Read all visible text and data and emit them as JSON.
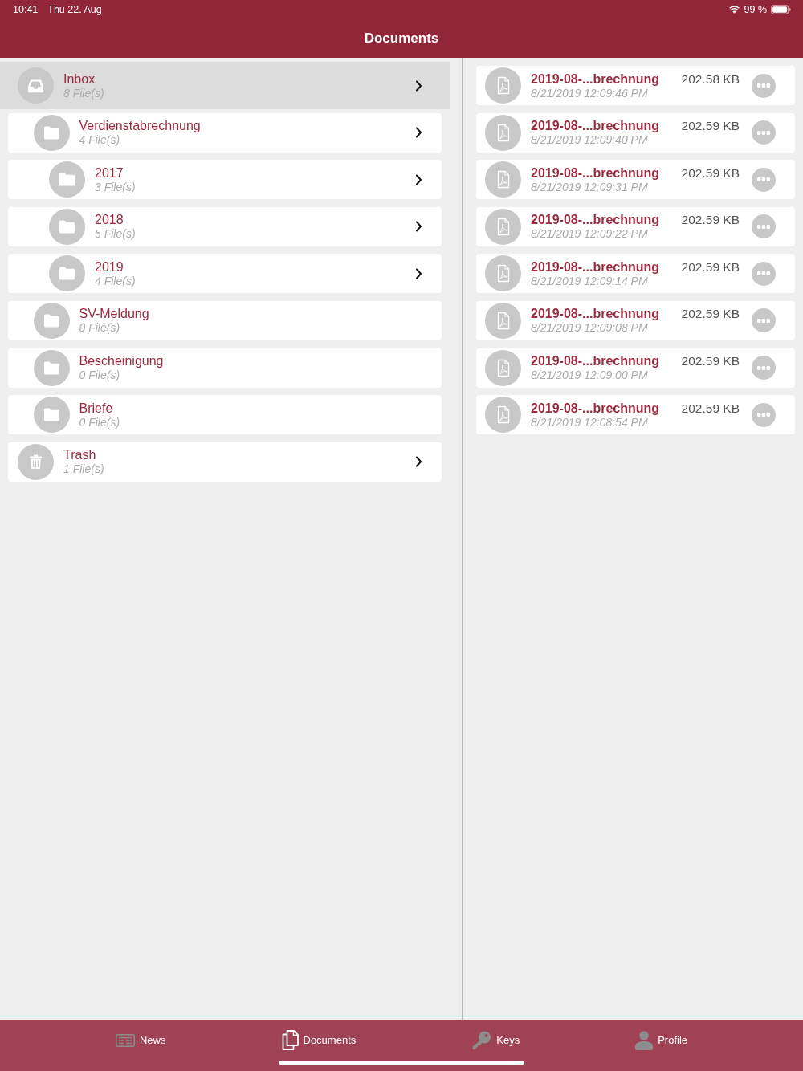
{
  "status_bar": {
    "time": "10:41",
    "date": "Thu 22. Aug",
    "battery": "99 %"
  },
  "header": {
    "title": "Documents"
  },
  "folders": [
    {
      "kind": "inbox",
      "name": "Inbox",
      "count": "8 File(s)",
      "selected": true,
      "chevron": true,
      "children": [
        {
          "kind": "folder",
          "name": "Verdienstabrechnung",
          "count": "4 File(s)",
          "selected": false,
          "chevron": true,
          "children": [
            {
              "kind": "folder",
              "name": "2017",
              "count": "3 File(s)",
              "selected": false,
              "chevron": true
            },
            {
              "kind": "folder",
              "name": "2018",
              "count": "5 File(s)",
              "selected": false,
              "chevron": true
            },
            {
              "kind": "folder",
              "name": "2019",
              "count": "4 File(s)",
              "selected": false,
              "chevron": true
            }
          ]
        },
        {
          "kind": "folder",
          "name": "SV-Meldung",
          "count": "0 File(s)",
          "selected": false,
          "chevron": false
        },
        {
          "kind": "folder",
          "name": "Bescheinigung",
          "count": "0 File(s)",
          "selected": false,
          "chevron": false
        },
        {
          "kind": "folder",
          "name": "Briefe",
          "count": "0 File(s)",
          "selected": false,
          "chevron": false
        }
      ]
    },
    {
      "kind": "trash",
      "name": "Trash",
      "count": "1 File(s)",
      "selected": false,
      "chevron": true
    }
  ],
  "files": [
    {
      "name": "2019-08-...brechnung",
      "date": "8/21/2019 12:09:46 PM",
      "size": "202.58 KB"
    },
    {
      "name": "2019-08-...brechnung",
      "date": "8/21/2019 12:09:40 PM",
      "size": "202.59 KB"
    },
    {
      "name": "2019-08-...brechnung",
      "date": "8/21/2019 12:09:31 PM",
      "size": "202.59 KB"
    },
    {
      "name": "2019-08-...brechnung",
      "date": "8/21/2019 12:09:22 PM",
      "size": "202.59 KB"
    },
    {
      "name": "2019-08-...brechnung",
      "date": "8/21/2019 12:09:14 PM",
      "size": "202.59 KB"
    },
    {
      "name": "2019-08-...brechnung",
      "date": "8/21/2019 12:09:08 PM",
      "size": "202.59 KB"
    },
    {
      "name": "2019-08-...brechnung",
      "date": "8/21/2019 12:09:00 PM",
      "size": "202.59 KB"
    },
    {
      "name": "2019-08-...brechnung",
      "date": "8/21/2019 12:08:54 PM",
      "size": "202.59 KB"
    }
  ],
  "tab_bar": [
    {
      "label": "News",
      "selected": false
    },
    {
      "label": "Documents",
      "selected": true
    },
    {
      "label": "Keys",
      "selected": false
    },
    {
      "label": "Profile",
      "selected": false
    }
  ]
}
